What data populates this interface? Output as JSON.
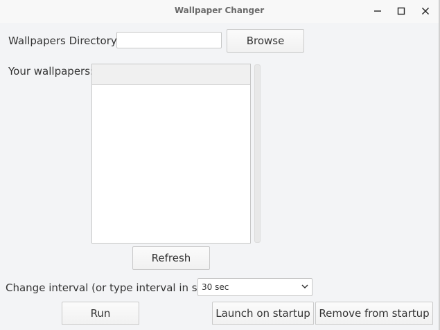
{
  "window": {
    "title": "Wallpaper Changer",
    "controls": {
      "minimize_icon": "minimize-icon",
      "maximize_icon": "maximize-icon",
      "close_icon": "close-icon"
    }
  },
  "directory": {
    "label": "Wallpapers Directory:",
    "value": "",
    "placeholder": "",
    "browse_label": "Browse"
  },
  "wallpapers": {
    "label": "Your wallpapers:",
    "items": [],
    "refresh_label": "Refresh"
  },
  "interval": {
    "label": "Change interval (or type interval in sec):",
    "selected": "30 sec"
  },
  "actions": {
    "run_label": "Run",
    "launch_label": "Launch on startup",
    "remove_label": "Remove from startup"
  },
  "colors": {
    "background": "#f3f4f6",
    "titlebar": "#f8f8f8",
    "text": "#333333",
    "border": "#c6c6c6"
  }
}
